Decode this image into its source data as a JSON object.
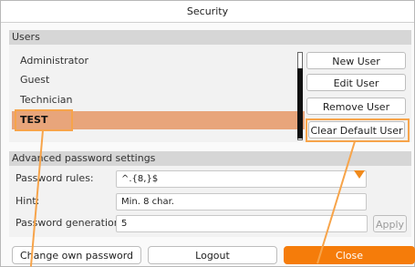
{
  "window": {
    "title": "Security"
  },
  "users_section": {
    "header": "Users",
    "items": [
      "Administrator",
      "Guest",
      "Technician",
      "TEST"
    ],
    "selected_index": 3,
    "buttons": {
      "new_user": "New User",
      "edit_user": "Edit User",
      "remove_user": "Remove User",
      "clear_default_user": "Clear Default User"
    }
  },
  "advanced_section": {
    "header": "Advanced password settings",
    "password_rules_label": "Password rules:",
    "password_rules_value": "^.{8,}$",
    "hint_label": "Hint:",
    "hint_value": "Min. 8 char.",
    "generations_label": "Password generations:",
    "generations_value": "5",
    "apply_label": "Apply"
  },
  "footer": {
    "change_password": "Change own password",
    "logout": "Logout",
    "close": "Close"
  },
  "colors": {
    "accent_orange": "#f57c0a",
    "highlight_orange": "#f7a44a",
    "selected_row": "#e8a57b"
  },
  "icons": {
    "dropdown": "dropdown-arrow-icon"
  }
}
